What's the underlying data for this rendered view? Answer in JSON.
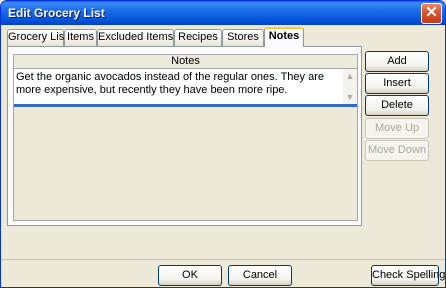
{
  "window": {
    "title": "Edit Grocery List"
  },
  "icons": {
    "close": "close-icon"
  },
  "tabs": [
    {
      "label": "Grocery List",
      "active": false
    },
    {
      "label": "Items",
      "active": false
    },
    {
      "label": "Excluded Items",
      "active": false
    },
    {
      "label": "Recipes",
      "active": false
    },
    {
      "label": "Stores",
      "active": false
    },
    {
      "label": "Notes",
      "active": true
    }
  ],
  "notes": {
    "column_header": "Notes",
    "rows": [
      "Get the organic avocados instead of the regular ones. They are more expensive, but recently they have been more ripe."
    ]
  },
  "side_buttons": {
    "add": "Add",
    "insert": "Insert",
    "delete": "Delete",
    "move_up": "Move Up",
    "move_down": "Move Down"
  },
  "footer": {
    "ok": "OK",
    "cancel": "Cancel",
    "check_spelling": "Check Spelling"
  }
}
